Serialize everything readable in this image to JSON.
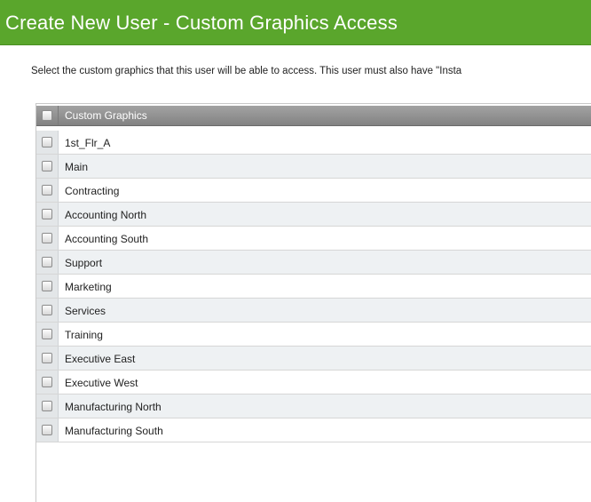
{
  "window": {
    "title": "Create New User - Custom Graphics Access"
  },
  "instructions": "Select the custom graphics that this user will be able to access. This user must also have \"Insta",
  "grid": {
    "header": "Custom Graphics",
    "rows": [
      "1st_Flr_A",
      "Main",
      "Contracting",
      "Accounting North",
      "Accounting South",
      "Support",
      "Marketing",
      "Services",
      "Training",
      "Executive East",
      "Executive West",
      "Manufacturing North",
      "Manufacturing South"
    ]
  },
  "colors": {
    "titlebar": "#5aa62c",
    "header": "#8f8f8f",
    "row_alt": "#eef1f3"
  }
}
